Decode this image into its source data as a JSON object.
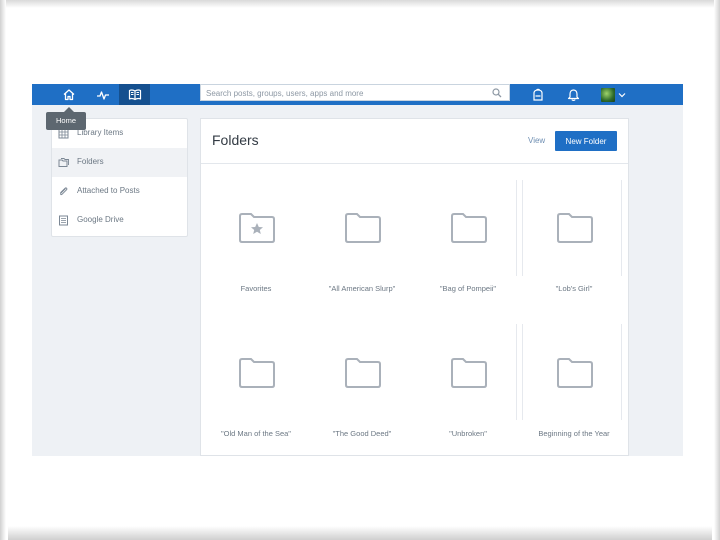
{
  "topbar": {
    "nav": [
      {
        "name": "home",
        "icon": "home-icon"
      },
      {
        "name": "activity",
        "icon": "activity-icon"
      },
      {
        "name": "library",
        "icon": "book-icon"
      }
    ],
    "search_placeholder": "Search posts, groups, users, apps and more",
    "tooltip": "Home",
    "colors": {
      "bar": "#1f6fc5",
      "active": "#15508f"
    }
  },
  "sidebar": {
    "items": [
      {
        "label": "Library Items",
        "icon": "grid-icon"
      },
      {
        "label": "Folders",
        "icon": "folders-icon"
      },
      {
        "label": "Attached to Posts",
        "icon": "paperclip-icon"
      },
      {
        "label": "Google Drive",
        "icon": "document-icon"
      }
    ]
  },
  "main": {
    "title": "Folders",
    "view_label": "View",
    "new_folder_label": "New Folder",
    "folders": [
      {
        "label": "Favorites",
        "icon": "star-folder-icon"
      },
      {
        "label": "\"All American Slurp\"",
        "icon": "folder-icon"
      },
      {
        "label": "\"Bag of Pompeii\"",
        "icon": "folder-icon"
      },
      {
        "label": "\"Lob's Girl\"",
        "icon": "folder-icon"
      },
      {
        "label": "\"Old Man of the Sea\"",
        "icon": "folder-icon"
      },
      {
        "label": "\"The Good Deed\"",
        "icon": "folder-icon"
      },
      {
        "label": "\"Unbroken\"",
        "icon": "folder-icon"
      },
      {
        "label": "Beginning of the Year",
        "icon": "folder-icon"
      }
    ]
  }
}
